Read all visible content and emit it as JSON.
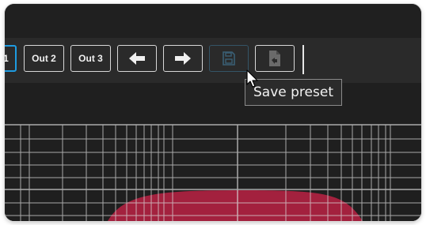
{
  "toolbar": {
    "out1_label": "1",
    "out2_label": "Out 2",
    "out3_label": "Out 3",
    "prev_icon": "arrow-left-icon",
    "next_icon": "arrow-right-icon",
    "save_icon": "save-disk-icon",
    "load_icon": "load-file-icon"
  },
  "tooltip": {
    "text": "Save preset"
  },
  "colors": {
    "accent": "#1e9be0",
    "curve": "#a3213e",
    "grid": "#d9d9d9",
    "background": "#1f1f1f"
  }
}
